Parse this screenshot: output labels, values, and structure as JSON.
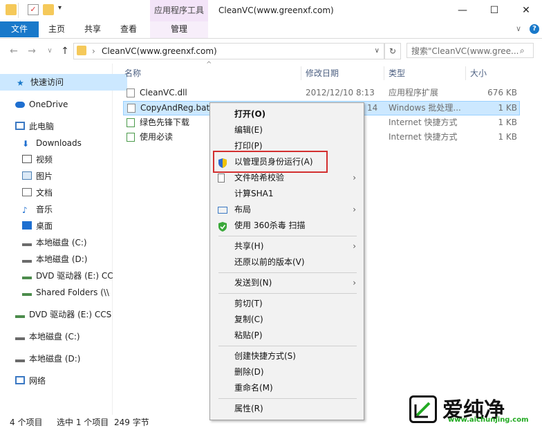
{
  "window": {
    "title": "CleanVC(www.greenxf.com)",
    "contextual_tab_group": "应用程序工具",
    "controls": [
      "—",
      "☐",
      "✕"
    ]
  },
  "ribbon": {
    "file_tab": "文件",
    "tabs": [
      "主页",
      "共享",
      "查看"
    ],
    "manage_tab": "管理",
    "expand_icon": "∨",
    "help_icon": "?"
  },
  "address": {
    "path": "CleanVC(www.greenxf.com)",
    "search_placeholder": "搜索\"CleanVC(www.gree..."
  },
  "nav": {
    "quick_access": "快速访问",
    "onedrive": "OneDrive",
    "this_pc": "此电脑",
    "downloads": "Downloads",
    "videos": "视频",
    "pictures": "图片",
    "documents": "文档",
    "music": "音乐",
    "desktop": "桌面",
    "disk_c": "本地磁盘 (C:)",
    "disk_d": "本地磁盘 (D:)",
    "dvd_e": "DVD 驱动器 (E:) CC",
    "shared": "Shared Folders (\\\\",
    "dvd_root": "DVD 驱动器 (E:) CCS",
    "disk_c2": "本地磁盘 (C:)",
    "disk_d2": "本地磁盘 (D:)",
    "network": "网络"
  },
  "columns": {
    "name": "名称",
    "date": "修改日期",
    "type": "类型",
    "size": "大小"
  },
  "files": [
    {
      "name": "CleanVC.dll",
      "date": "2012/12/10 8:13",
      "type": "应用程序扩展",
      "size": "676 KB"
    },
    {
      "name": "CopyAndReg.bat",
      "date": "14",
      "type": "Windows 批处理...",
      "size": "1 KB"
    },
    {
      "name": "绿色先锋下载",
      "date": "",
      "type": "Internet 快捷方式",
      "size": "1 KB"
    },
    {
      "name": "使用必读",
      "date": "",
      "type": "Internet 快捷方式",
      "size": "1 KB"
    }
  ],
  "status": {
    "count": "4 个项目",
    "selected": "选中 1 个项目",
    "size": "249 字节"
  },
  "context_menu": {
    "open": "打开(O)",
    "edit": "编辑(E)",
    "print": "打印(P)",
    "run_as_admin": "以管理员身份运行(A)",
    "hash": "文件哈希校验",
    "sha1": "计算SHA1",
    "layout": "布局",
    "scan360": "使用 360杀毒 扫描",
    "share": "共享(H)",
    "restore": "还原以前的版本(V)",
    "sendto": "发送到(N)",
    "cut": "剪切(T)",
    "copy": "复制(C)",
    "paste": "粘贴(P)",
    "shortcut": "创建快捷方式(S)",
    "delete": "删除(D)",
    "rename": "重命名(M)",
    "properties": "属性(R)"
  },
  "watermark": {
    "brand": "爱纯净",
    "url": "www.aichunjing.com"
  },
  "colors": {
    "accent": "#1979ca",
    "selection": "#cce8ff",
    "highlight_border": "#d32f2f",
    "context_tab": "#f3e4f8"
  }
}
